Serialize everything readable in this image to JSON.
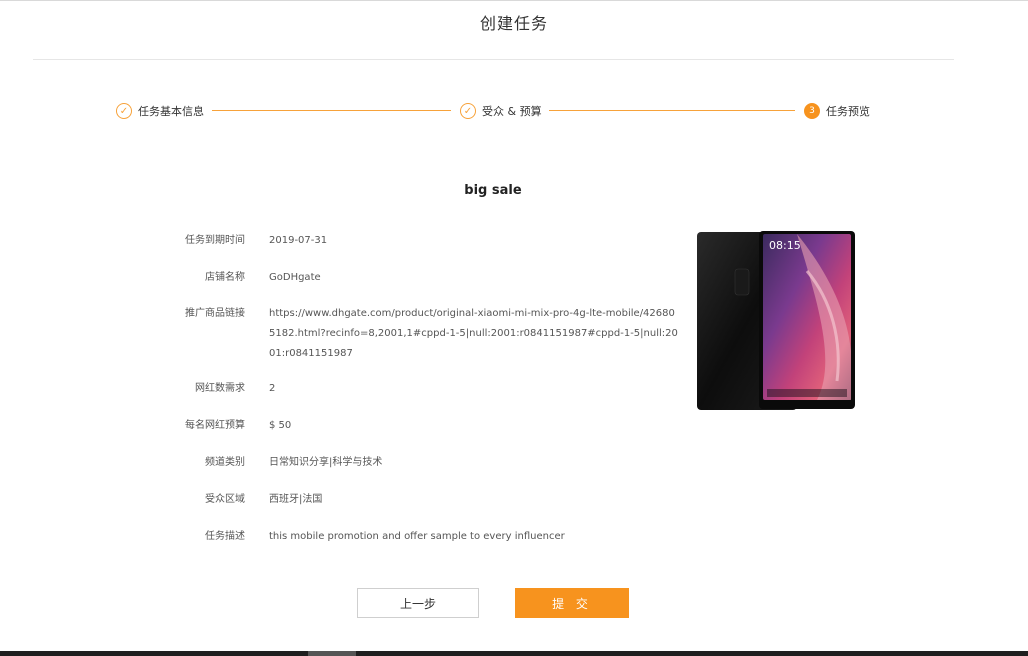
{
  "page": {
    "title": "创建任务"
  },
  "steps": [
    {
      "label": "任务基本信息",
      "state": "done",
      "icon": "check-icon"
    },
    {
      "label": "受众 & 预算",
      "state": "done",
      "icon": "check-icon"
    },
    {
      "label": "任务预览",
      "state": "active",
      "number": "3"
    }
  ],
  "preview": {
    "task_name": "big sale",
    "fields": [
      {
        "label": "任务到期时间",
        "value": "2019-07-31"
      },
      {
        "label": "店铺名称",
        "value": "GoDHgate"
      },
      {
        "label": "推广商品链接",
        "value": "https://www.dhgate.com/product/original-xiaomi-mi-mix-pro-4g-lte-mobile/426805182.html?recinfo=8,2001,1#cppd-1-5|null:2001:r0841151987#cppd-1-5|null:2001:r0841151987"
      },
      {
        "label": "网红数需求",
        "value": "2"
      },
      {
        "label": "每名网红预算",
        "value": "$ 50"
      },
      {
        "label": "频道类别",
        "value": "日常知识分享|科学与技术"
      },
      {
        "label": "受众区域",
        "value": "西班牙|法国"
      },
      {
        "label": "任务描述",
        "value": "this mobile promotion and offer sample to every influencer"
      }
    ],
    "phone_time": "08:15"
  },
  "buttons": {
    "prev_label": "上一步",
    "submit_label": "提 交"
  },
  "colors": {
    "accent": "#f7931e",
    "text": "#333333",
    "muted": "#555555"
  }
}
